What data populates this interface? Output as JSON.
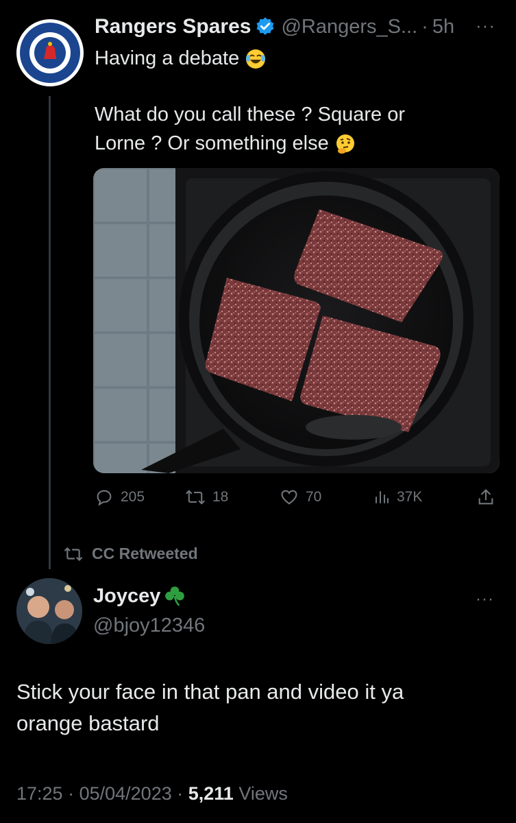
{
  "tweet": {
    "author_name": "Rangers Spares",
    "author_handle": "@Rangers_S...",
    "time": "5h",
    "more_icon": "more-icon",
    "line1": "Having a debate",
    "line2": "What do you call these ? Square or",
    "line3": "Lorne ? Or something else",
    "actions": {
      "replies": "205",
      "retweets": "18",
      "likes": "70",
      "views": "37K"
    }
  },
  "retweet_banner": {
    "label": "CC Retweeted"
  },
  "reply": {
    "author_name": "Joycey",
    "author_handle": "@bjoy12346",
    "text_line1": "Stick your face in that pan and video it ya",
    "text_line2": "orange bastard",
    "time": "17:25",
    "date": "05/04/2023",
    "views_count": "5,211",
    "views_label": "Views"
  },
  "colors": {
    "background": "#000000",
    "text": "#e7e9ea",
    "muted": "#71767b",
    "verified": "#1d9bf0",
    "shamrock": "#2e9e3f"
  }
}
